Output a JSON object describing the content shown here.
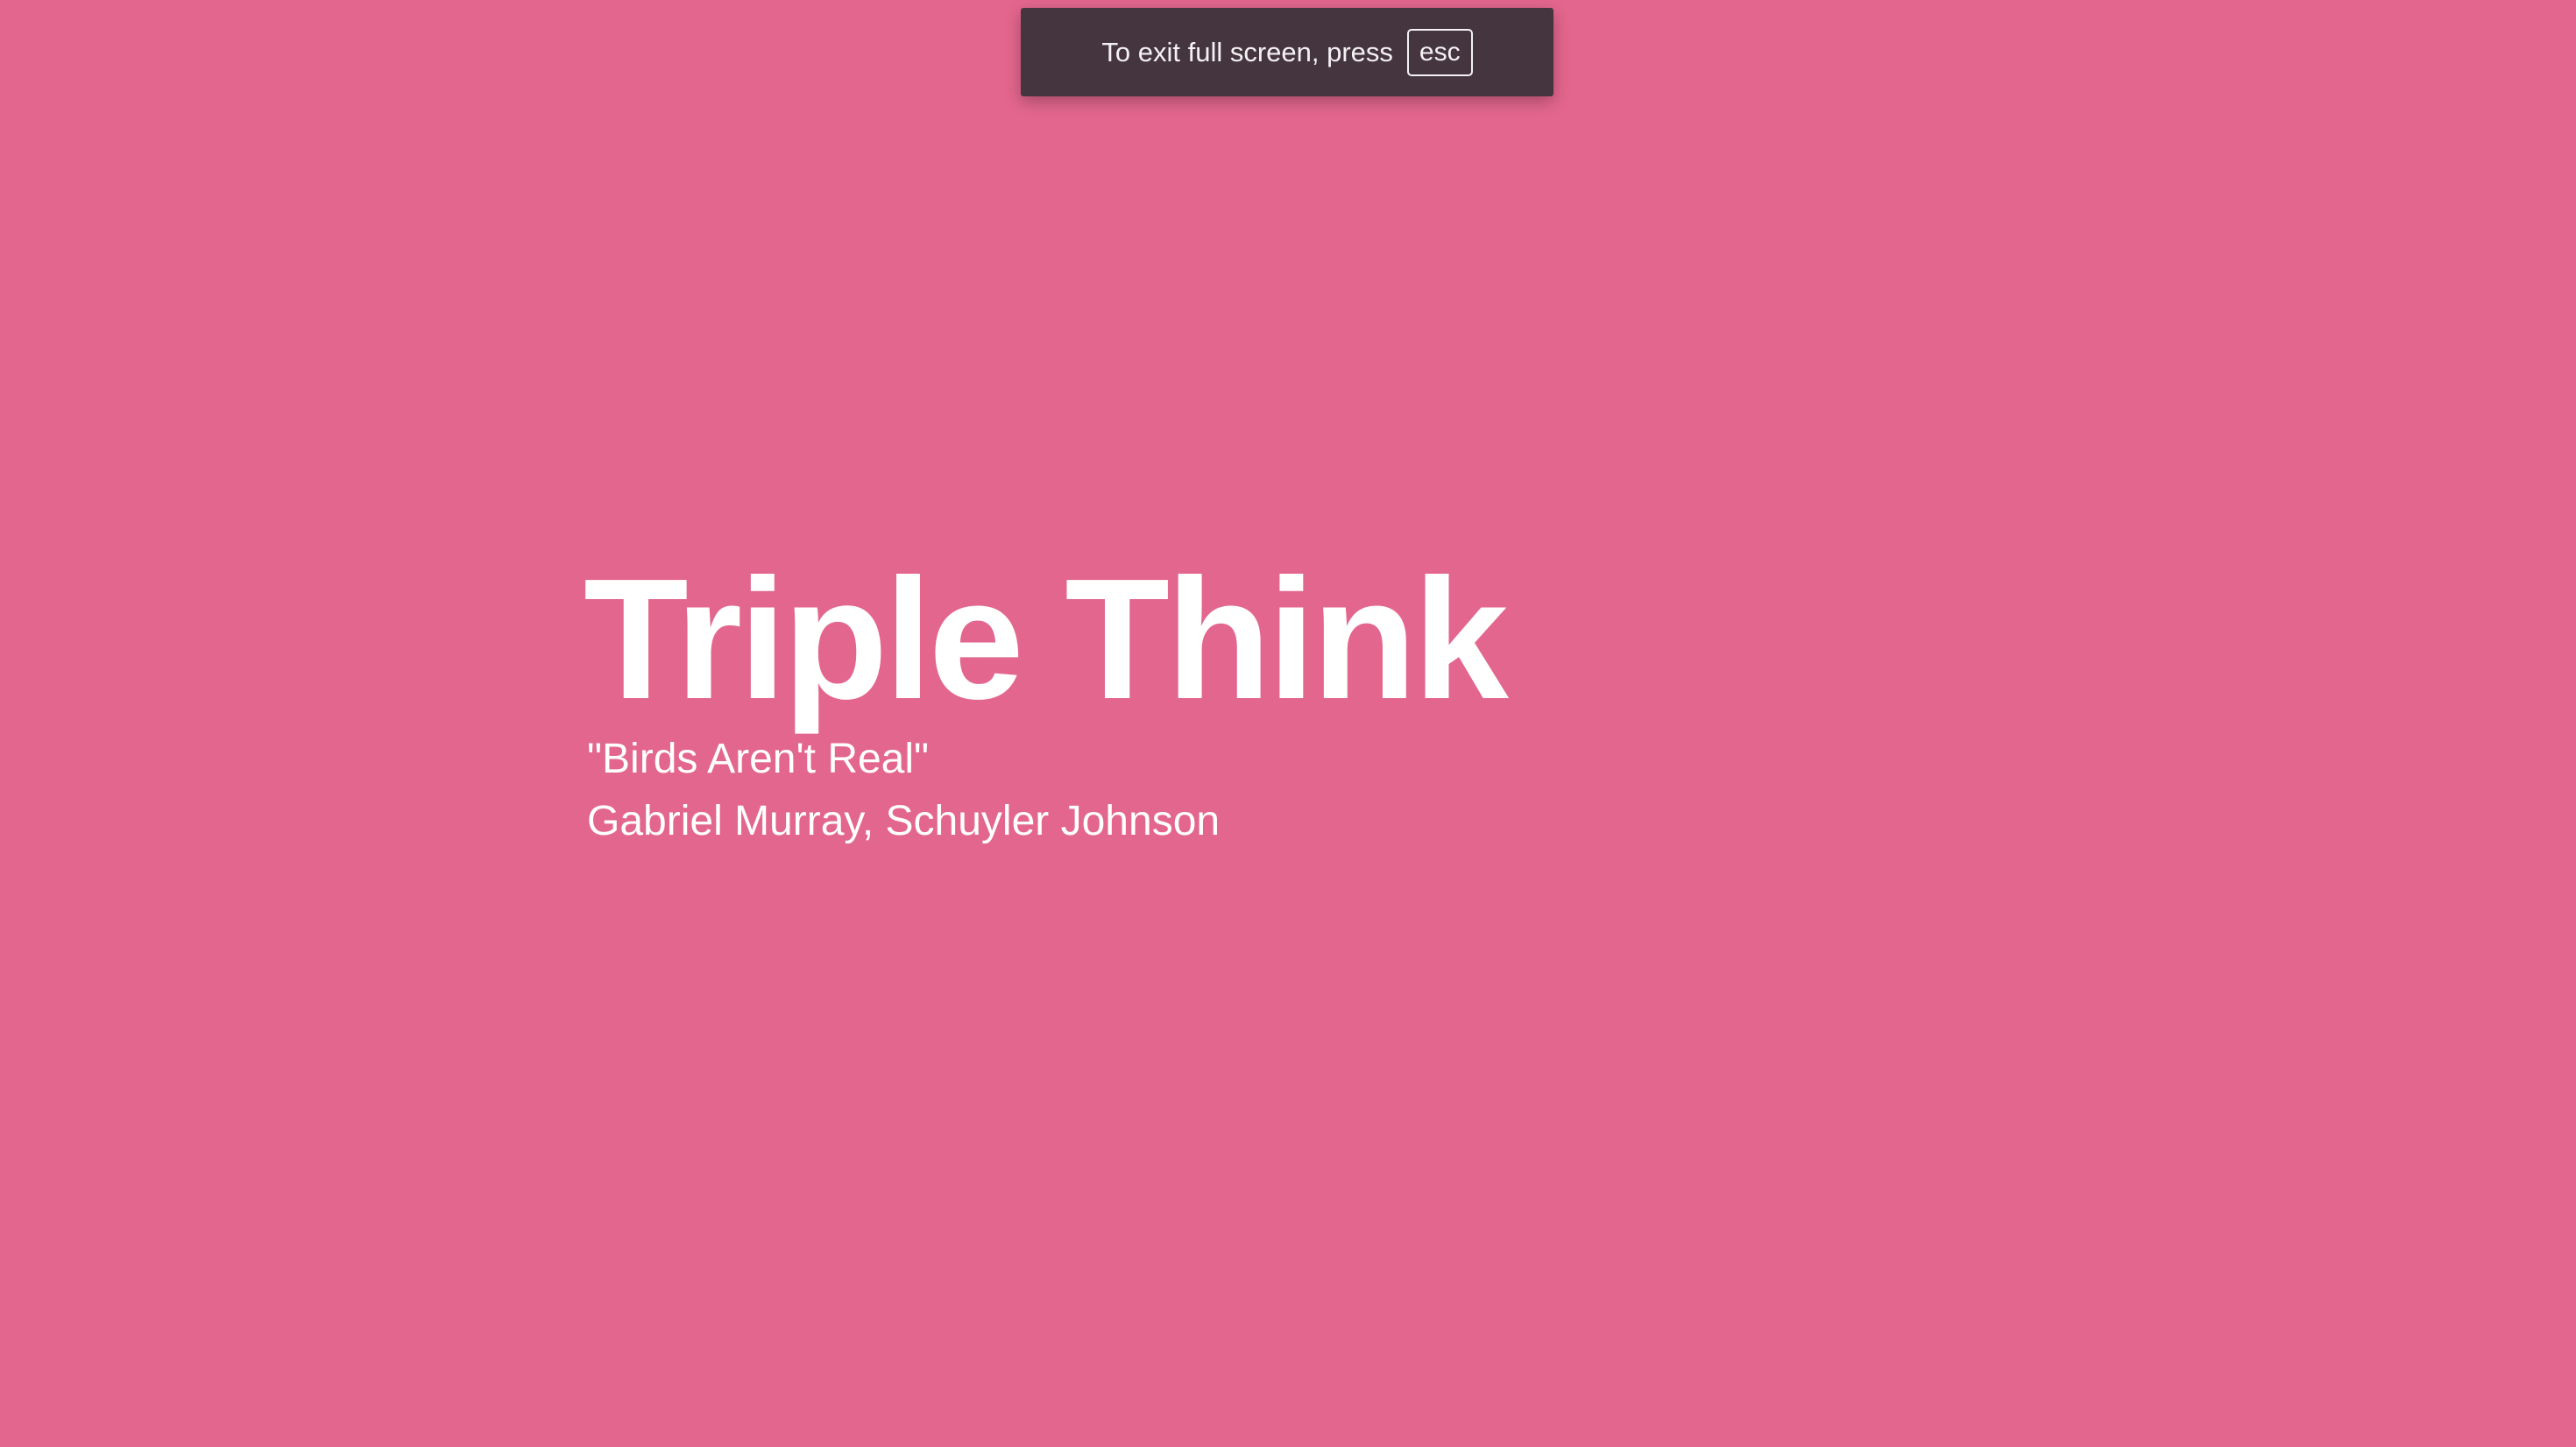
{
  "fullscreen_notice": {
    "message": "To exit full screen, press",
    "key_label": "esc"
  },
  "slide": {
    "title": "Triple Think",
    "subtitle": "\"Birds Aren't Real\"",
    "authors": "Gabriel Murray, Schuyler Johnson"
  },
  "colors": {
    "background": "#e3668e",
    "banner": "#45353f",
    "text": "#ffffff"
  }
}
